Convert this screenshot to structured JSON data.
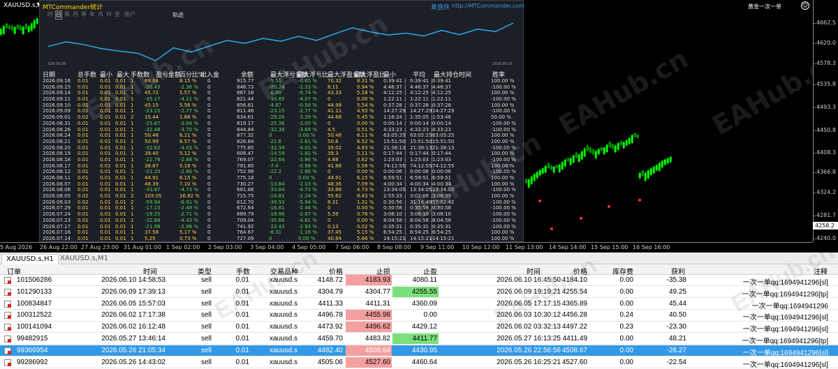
{
  "chart": {
    "symbol_title": "XAUUSD.s,H1",
    "ea_name": "黄金一次一单",
    "ea_face": "☺",
    "price_labels": [
      "4662.5",
      "4620.0",
      "4578.3",
      "4535.8",
      "4493.3",
      "4450.8",
      "4408.3",
      "4366.8",
      "4324.2",
      "4281.7",
      "4258.2",
      "4240.0"
    ],
    "current_price": "4258.2",
    "time_labels": [
      "5 Aug 2026",
      "26 Aug 22:00",
      "27 Aug 23:00",
      "31 Aug 01:00",
      "1 Sep 02:00",
      "2 Sep 03:00",
      "3 Sep 04:00",
      "4 Sep 05:00",
      "7 Sep 06:00",
      "8 Sep 08:00",
      "9 Sep 11:00",
      "10 Sep 12:00",
      "11 Sep 13:00",
      "14 Sep 14:00",
      "15 Sep 15:00",
      "16 Sep 16:00"
    ],
    "watermark": "EAHub.cn"
  },
  "panel": {
    "title": "MTCommander统计",
    "brand_cn": "复盘侠",
    "brand": "http://MTCommander.com",
    "period_tabs": [
      "时",
      "日",
      "周",
      "月",
      "季",
      "年",
      "币",
      "M",
      "金",
      "账户"
    ],
    "track_label": "轨迹",
    "mini_start": "026.06.09",
    "mini_end": "2026.09.16",
    "headers": [
      "日期",
      "总手数",
      "最小",
      "最大",
      "手数",
      "数",
      "盈亏金额",
      "百分比%",
      "出入金",
      "余额",
      "最大浮亏金额",
      "最大浮亏比",
      "最大浮盈金额",
      "最大浮盈比",
      "最小",
      "平均",
      "最大持仓时间",
      "胜率"
    ],
    "rows": [
      [
        "2026.09.16",
        "0.01",
        "0.01",
        "0.01",
        "1",
        "69.04",
        "8.15 %",
        "0",
        "915.77",
        "-5.51",
        "-0.65 %",
        "70.32",
        "8.31 %",
        "0:39:41",
        "0:39:41",
        "0:39:41",
        "100.00 %"
      ],
      [
        "2026.09.15",
        "0.01",
        "0.01",
        "0.01",
        "1",
        "-20.43",
        "-2.36 %",
        "0",
        "846.73",
        "-20.24",
        "-2.33 %",
        "8.11",
        "0.94 %",
        "4:46:37",
        "4:46:37",
        "4:46:37",
        "-100.00 %"
      ],
      [
        "2026.09.14",
        "0.01",
        "0.01",
        "0.01",
        "1",
        "45.72",
        "5.57 %",
        "0",
        "867.16",
        "-6.09",
        "-0.74 %",
        "43.33",
        "5.28 %",
        "4:12:25",
        "4:12:25",
        "4:12:25",
        "100.00 %"
      ],
      [
        "2026.09.11",
        "0.01",
        "0.01",
        "0.01",
        "1",
        "-35.17",
        "-4.11 %",
        "0",
        "821.44",
        "-34.85",
        "-4.07 %",
        "0",
        "0.00 %",
        "1:22:11",
        "1:22:11",
        "1:22:11",
        "-100.00 %"
      ],
      [
        "2026.09.10",
        "0.01",
        "0.01",
        "0.01",
        "1",
        "45.15",
        "5.56 %",
        "0",
        "856.61",
        "-4.67",
        "-0.58 %",
        "44.98",
        "5.54 %",
        "0:37:28",
        "0:37:28",
        "0:37:28",
        "100.00 %"
      ],
      [
        "2026.09.09",
        "0.01",
        "0.01",
        "0.01",
        "1",
        "-23.15",
        "-2.77 %",
        "0",
        "811.46",
        "-23.15",
        "-2.77 %",
        "41.11",
        "4.93 %",
        "14:27:29",
        "14:27:29",
        "14:27:29",
        "-100.00 %"
      ],
      [
        "2026.09.01",
        "0.02",
        "0.01",
        "0.01",
        "2",
        "15.44",
        "1.88 %",
        "0",
        "834.61",
        "-29.26",
        "-3.39 %",
        "44.68",
        "5.45 %",
        "1:16:24",
        "1:35:05",
        "1:53:46",
        "50.00 %"
      ],
      [
        "2026.08.31",
        "0.01",
        "0.01",
        "0.01",
        "1",
        "-25.67",
        "-3.04 %",
        "0",
        "819.17",
        "-25.36",
        "-3.00 %",
        "0",
        "0.00 %",
        "0:00:14",
        "0:00:14",
        "0:00:14",
        "-100.00 %"
      ],
      [
        "2026.08.26",
        "0.01",
        "0.01",
        "0.01",
        "1",
        "-32.48",
        "-3.70 %",
        "0",
        "844.84",
        "-32.36",
        "-3.69 %",
        "4.5",
        "0.51 %",
        "4:33:23",
        "4:33:23",
        "4:33:23",
        "-100.00 %"
      ],
      [
        "2026.08.24",
        "0.01",
        "0.01",
        "0.01",
        "1",
        "50.48",
        "6.11 %",
        "0",
        "877.32",
        "0",
        "0.00 %",
        "50.48",
        "6.11 %",
        "63:05:25",
        "63:05:25",
        "63:05:25",
        "100.00 %"
      ],
      [
        "2026.08.21",
        "0.01",
        "0.01",
        "0.01",
        "1",
        "50.99",
        "6.57 %",
        "0",
        "826.84",
        "-21.6",
        "-2.61 %",
        "50.6",
        "6.52 %",
        "15:51:50",
        "15:51:50",
        "15:51:50",
        "100.00 %"
      ],
      [
        "2026.08.20",
        "0.01",
        "0.01",
        "0.01",
        "1",
        "-32.62",
        "-4.03 %",
        "0",
        "775.85",
        "-32.39",
        "-4.01 %",
        "39.02",
        "4.83 %",
        "21:38:13",
        "21:38:13",
        "21:38:13",
        "-100.00 %"
      ],
      [
        "2026.08.19",
        "0.01",
        "0.01",
        "0.01",
        "1",
        "39.40",
        "5.12 %",
        "0",
        "808.47",
        "-14.59",
        "-1.81 %",
        "39.3",
        "5.11 %",
        "0:17:44",
        "0:17:44",
        "0:17:44",
        "100.00 %"
      ],
      [
        "2026.08.18",
        "0.01",
        "0.01",
        "0.01",
        "1",
        "-22.78",
        "-2.88 %",
        "0",
        "769.07",
        "-22.64",
        "-2.86 %",
        "4.88",
        "0.62 %",
        "1:23:03",
        "1:23:03",
        "1:23:03",
        "-100.00 %"
      ],
      [
        "2026.08.17",
        "0.01",
        "0.01",
        "0.01",
        "1",
        "38.87",
        "5.16 %",
        "0",
        "791.85",
        "-7.4",
        "-0.98 %",
        "41.88",
        "5.56 %",
        "74:12:55",
        "74:12:55",
        "74:12:55",
        "100.00 %"
      ],
      [
        "2026.08.12",
        "0.01",
        "0.01",
        "0.01",
        "1",
        "-22.20",
        "-2.86 %",
        "0",
        "752.98",
        "-22.2",
        "-2.86 %",
        "0",
        "0.00 %",
        "0:00:06",
        "0:00:06",
        "0:00:06",
        "-100.00 %"
      ],
      [
        "2026.08.11",
        "0.01",
        "0.01",
        "0.01",
        "1",
        "44.91",
        "6.15 %",
        "0",
        "775.18",
        "0",
        "0.00 %",
        "44.91",
        "6.15 %",
        "6:59:51",
        "6:59:51",
        "6:59:51",
        "100.00 %"
      ],
      [
        "2026.08.07",
        "0.01",
        "0.01",
        "0.01",
        "1",
        "48.39",
        "7.10 %",
        "0",
        "730.27",
        "-13.84",
        "-2.03 %",
        "48.36",
        "7.09 %",
        "4:00:34",
        "4:00:34",
        "4:00:34",
        "100.00 %"
      ],
      [
        "2026.08.06",
        "0.01",
        "0.01",
        "0.01",
        "1",
        "-33.87",
        "-4.73 %",
        "0",
        "681.88",
        "-33.84",
        "-4.73 %",
        "33.88",
        "4.73 %",
        "13:34:05",
        "13:34:05",
        "13:34:05",
        "-100.00 %"
      ],
      [
        "2026.08.05",
        "0.02",
        "0.01",
        "0.01",
        "2",
        "103.05",
        "16.82 %",
        "0",
        "715.75",
        "-14.81",
        "-2.24 %",
        "55.62",
        "8.43 %",
        "2:55:33",
        "3:02:06",
        "3:08:39",
        "100.00 %"
      ],
      [
        "2026.08.03",
        "0.02",
        "0.01",
        "0.01",
        "2",
        "-59.94",
        "-8.91 %",
        "0",
        "612.70",
        "-39.93",
        "-5.94 %",
        "8.31",
        "1.31 %",
        "0:30:56",
        "31:16:49",
        "57:02:42",
        "-100.00 %"
      ],
      [
        "2026.07.29",
        "0.01",
        "0.01",
        "0.01",
        "1",
        "-17.15",
        "-2.49 %",
        "0",
        "672.64",
        "-16.81",
        "-2.44 %",
        "0",
        "0.00 %",
        "0:30:58",
        "0:30:58",
        "0:30:58",
        "-100.00 %"
      ],
      [
        "2026.07.24",
        "0.01",
        "0.01",
        "0.01",
        "1",
        "-19.25",
        "-2.71 %",
        "0",
        "689.79",
        "-18.96",
        "-2.67 %",
        "5.39",
        "0.76 %",
        "3:08:10",
        "3:08:10",
        "3:08:10",
        "-100.00 %"
      ],
      [
        "2026.07.23",
        "0.01",
        "0.01",
        "0.01",
        "1",
        "-32.88",
        "-4.43 %",
        "0",
        "709.04",
        "-35.66",
        "-4.81 %",
        "0",
        "0.00 %",
        "8:04:58",
        "8:04:58",
        "8:04:58",
        "-100.00 %"
      ],
      [
        "2026.07.17",
        "0.01",
        "0.01",
        "0.01",
        "1",
        "-21.98",
        "-2.98 %",
        "0",
        "741.92",
        "-22.43",
        "-2.93 %",
        "0.13",
        "0.02 %",
        "0:35:31",
        "0:35:31",
        "0:35:31",
        "-100.00 %"
      ],
      [
        "2026.07.16",
        "0.01",
        "0.01",
        "0.01",
        "1",
        "37.58",
        "5.17 %",
        "0",
        "764.67",
        "-8.31",
        "-1.16 %",
        "37.45",
        "5.15 %",
        "6:54:25",
        "6:54:25",
        "6:54:25",
        "100.00 %"
      ],
      [
        "2026.07.14",
        "0.01",
        "0.01",
        "0.01",
        "1",
        "5.25",
        "0.73 %",
        "0",
        "727.09",
        "0",
        "0.00 %",
        "40.84",
        "5.66 %",
        "14:15:21",
        "14:15:21",
        "14:15:21",
        "100.00 %"
      ]
    ]
  },
  "chart_tabs": [
    "XAUUSD.s,H1",
    "XAUUSD.s,M1"
  ],
  "orders": {
    "headers": [
      "订单",
      "时间",
      "类型",
      "手数",
      "交易品种",
      "价格",
      "止损",
      "止盈",
      "时间",
      "价格",
      "库存费",
      "获利",
      "注释"
    ],
    "rows": [
      {
        "ticket": "101506286",
        "open_time": "2026.06.10 14:58:53",
        "type": "sell",
        "lots": "0.01",
        "symbol": "xauusd.s",
        "price": "4148.72",
        "sl": "4183.93",
        "tp": "4080.11",
        "close_time": "2026.06.10 16:45:50",
        "close_price": "4184.10",
        "swap": "0.00",
        "profit": "-35.38",
        "comment": "一次一单qq:1694941296[sl]",
        "sl_hit": true,
        "tp_hit": false
      },
      {
        "ticket": "101290133",
        "open_time": "2026.06.09 17:39:13",
        "type": "sell",
        "lots": "0.01",
        "symbol": "xauusd.s",
        "price": "4304.79",
        "sl": "4304.77",
        "tp": "4255.55",
        "close_time": "2026.06.09 19:19:21",
        "close_price": "4255.54",
        "swap": "0.00",
        "profit": "49.25",
        "comment": "一次一单qq:1694941296[tp]",
        "sl_hit": false,
        "tp_hit": true
      },
      {
        "ticket": "100834847",
        "open_time": "2026.06.05 15:57:03",
        "type": "sell",
        "lots": "0.01",
        "symbol": "xauusd.s",
        "price": "4411.33",
        "sl": "4411.31",
        "tp": "4360.09",
        "close_time": "2026.06.05 17:17:15",
        "close_price": "4365.89",
        "swap": "0.00",
        "profit": "45.44",
        "comment": "一次一单qq:1694941296",
        "sl_hit": false,
        "tp_hit": false
      },
      {
        "ticket": "100312522",
        "open_time": "2026.06.02 17:17:38",
        "type": "sell",
        "lots": "0.01",
        "symbol": "xauusd.s",
        "price": "4496.78",
        "sl": "4455.98",
        "tp": "0.00",
        "close_time": "2026.06.03 10:30:12",
        "close_price": "4456.28",
        "swap": "0.24",
        "profit": "40.50",
        "comment": "一次一单qq:1694941296[sl]",
        "sl_hit": true,
        "tp_hit": false
      },
      {
        "ticket": "100141094",
        "open_time": "2026.06.02 16:12:48",
        "type": "sell",
        "lots": "0.01",
        "symbol": "xauusd.s",
        "price": "4473.92",
        "sl": "4496.62",
        "tp": "4429.12",
        "close_time": "2026.06.02 03:32:13",
        "close_price": "4497.22",
        "swap": "0.23",
        "profit": "-23.30",
        "comment": "一次一单qq:1694941296[sl]",
        "sl_hit": true,
        "tp_hit": false
      },
      {
        "ticket": "99482915",
        "open_time": "2026.05.27 13:46:14",
        "type": "sell",
        "lots": "0.01",
        "symbol": "xauusd.s",
        "price": "4459.70",
        "sl": "4483.82",
        "tp": "4411.77",
        "close_time": "2026.05.27 16:13:25",
        "close_price": "4411.49",
        "swap": "0.00",
        "profit": "48.21",
        "comment": "一次一单qq:1694941296[tp]",
        "sl_hit": false,
        "tp_hit": true
      },
      {
        "ticket": "99366954",
        "open_time": "2026.05.26 21:05:34",
        "type": "sell",
        "lots": "0.01",
        "symbol": "xauusd.s",
        "price": "4482.40",
        "sl": "4508.64",
        "tp": "4430.95",
        "close_time": "2026.05.26 22:56:56",
        "close_price": "4508.67",
        "swap": "0.00",
        "profit": "-26.27",
        "comment": "一次一单qq:1694941296[sl]",
        "sl_hit": true,
        "tp_hit": false,
        "selected": true
      },
      {
        "ticket": "99286992",
        "open_time": "2026.05.26 14:43:02",
        "type": "sell",
        "lots": "0.01",
        "symbol": "xauusd.s",
        "price": "4505.06",
        "sl": "4527.60",
        "tp": "4460.64",
        "close_time": "2026.05.26 16:25:21",
        "close_price": "4527.60",
        "swap": "0.00",
        "profit": "-22.54",
        "comment": "一次一单qq:1694941296[sl]",
        "sl_hit": true,
        "tp_hit": false
      }
    ]
  },
  "colors": {
    "chart_bg": "#000000",
    "bull": "#00ff00",
    "panel_bg": "#1c1f26",
    "equity_line": "#29a3e6",
    "sl_hit": "#f4a0a0",
    "tp_hit": "#7be07b",
    "selected_row": "#3399e6"
  }
}
